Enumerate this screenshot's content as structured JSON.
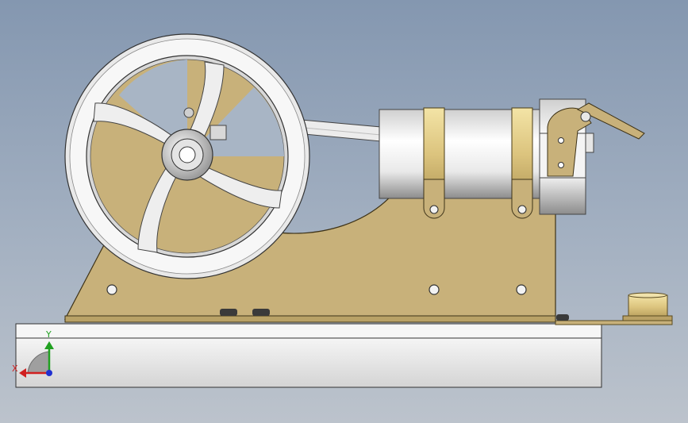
{
  "viewport": {
    "background_top": "#8497b0",
    "background_bottom": "#bcc3cc"
  },
  "model": {
    "components": [
      "base-block",
      "frame-plate",
      "flywheel",
      "connecting-rod",
      "cylinder",
      "cylinder-clamp-bands",
      "valve-head",
      "valve-lever",
      "burner-cup"
    ]
  },
  "colors": {
    "brass": "#c8b17a",
    "brass_dark": "#8f7a45",
    "brass_bright": "#e8d79a",
    "steel": "#e8e8e8",
    "steel_shadow": "#9a9a9a",
    "base": "#d6d6d6"
  },
  "triad": {
    "x_label": "X",
    "y_label": "Y",
    "x_color": "#d02020",
    "y_color": "#20a020",
    "z_color": "#2030d0"
  }
}
